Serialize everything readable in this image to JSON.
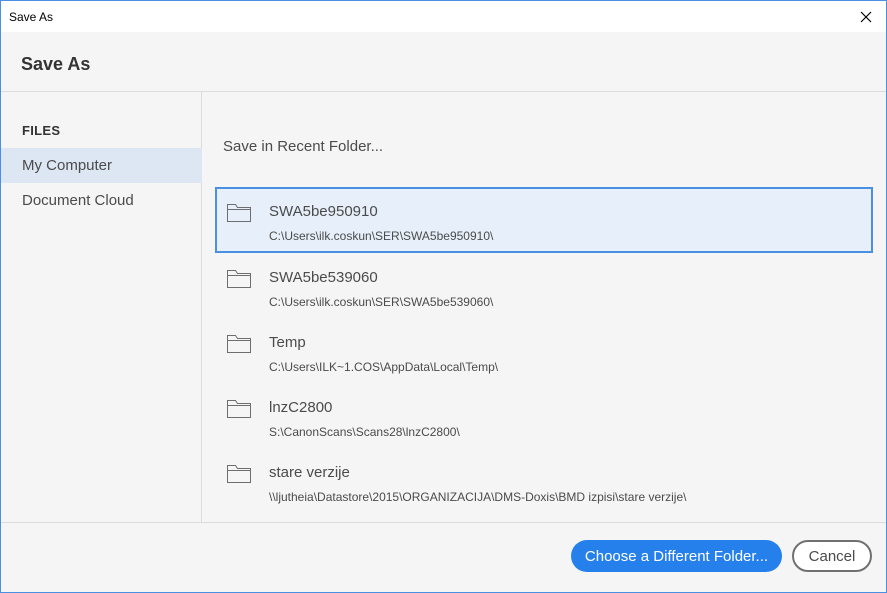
{
  "window": {
    "title": "Save As"
  },
  "header": {
    "heading": "Save As"
  },
  "sidebar": {
    "section_label": "FILES",
    "items": [
      {
        "label": "My Computer",
        "selected": true
      },
      {
        "label": "Document Cloud",
        "selected": false
      }
    ]
  },
  "main": {
    "recent_label": "Save in Recent Folder...",
    "folders": [
      {
        "name": "SWA5be950910",
        "path": "C:\\Users\\ilk.coskun\\SER\\SWA5be950910\\",
        "selected": true,
        "icon": "folder-icon"
      },
      {
        "name": "SWA5be539060",
        "path": "C:\\Users\\ilk.coskun\\SER\\SWA5be539060\\",
        "selected": false,
        "icon": "folder-icon"
      },
      {
        "name": "Temp",
        "path": "C:\\Users\\ILK~1.COS\\AppData\\Local\\Temp\\",
        "selected": false,
        "icon": "folder-icon"
      },
      {
        "name": "lnzC2800",
        "path": "S:\\CanonScans\\Scans28\\lnzC2800\\",
        "selected": false,
        "icon": "folder-icon"
      },
      {
        "name": "stare verzije",
        "path": "\\\\ljutheia\\Datastore\\2015\\ORGANIZACIJA\\DMS-Doxis\\BMD izpisi\\stare verzije\\",
        "selected": false,
        "icon": "folder-icon"
      }
    ]
  },
  "footer": {
    "choose_folder_label": "Choose a Different Folder...",
    "cancel_label": "Cancel"
  },
  "colors": {
    "accent": "#2680eb",
    "selection_border": "#4a90e2",
    "selection_bg": "#e6effa",
    "sidebar_selected_bg": "#dde6f3"
  }
}
